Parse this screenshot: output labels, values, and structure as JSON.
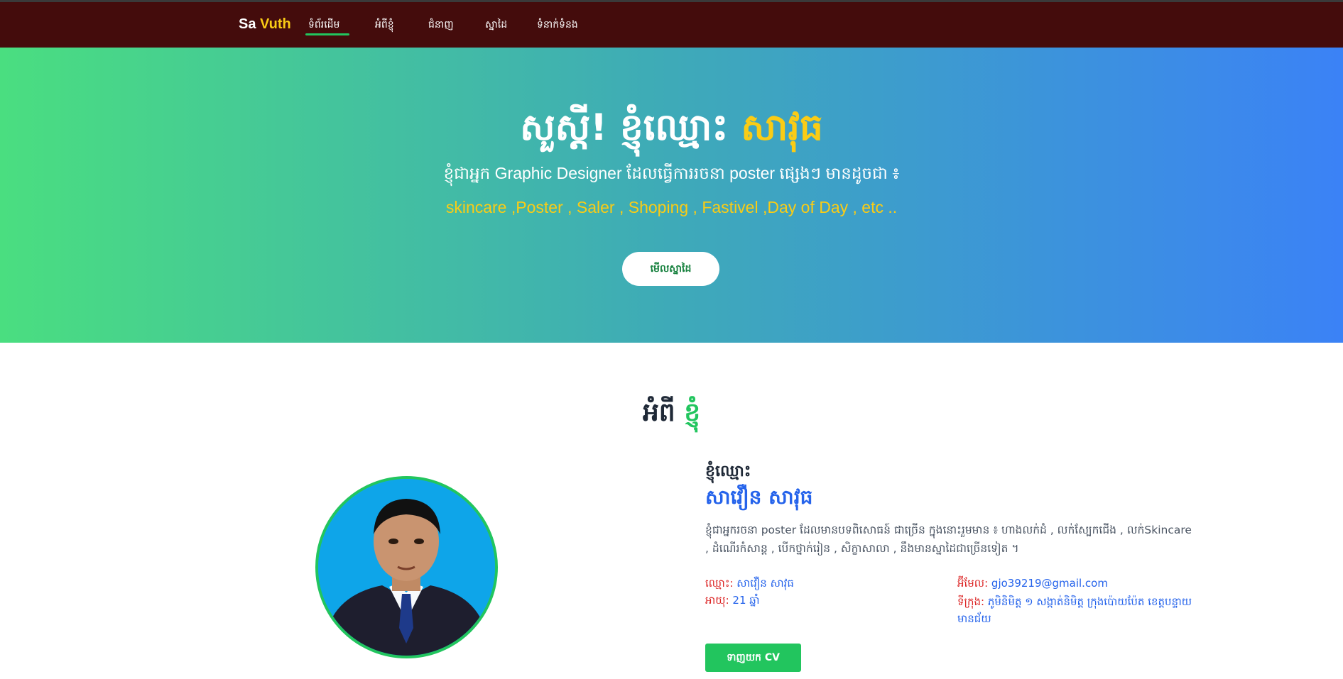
{
  "nav": {
    "brand_first": "Sa",
    "brand_second": "Vuth",
    "items": [
      "ទំព័រដើម",
      "អំពីខ្ញុំ",
      "ជំនាញ",
      "ស្នាដៃ",
      "ទំនាក់ទំនង"
    ],
    "active_index": 0
  },
  "hero": {
    "greeting": "សួស្តី! ខ្ញុំឈ្មោះ",
    "name": "សាវុធ",
    "subtitle": "ខ្ញុំជាអ្នក Graphic Designer ដែលធ្វើការរចនា poster ផ្សេងៗ មានដូចជា ៖",
    "tags": "skincare ,Poster , Saler , Shoping , Fastivel ,Day of Day , etc ..",
    "button_label": "មើលស្នាដៃ"
  },
  "about": {
    "heading_first": "អំពី",
    "heading_second": "ខ្ញុំ",
    "intro_label": "ខ្ញុំឈ្មោះ",
    "full_name": "សាវឿន សាវុធ",
    "bio": "ខ្ញុំជាអ្នករចនា poster ដែលមានបទពិសោធន៍ ជាច្រើន ក្នុងនោះរួមមាន ៖ ហាងលក់ដំ , លក់ស្បែកជើង , លក់Skincare , ដំណើរកំសាន្ត , បើកថ្នាក់រៀន , សិក្ខាសាលា , នឹងមានស្នាដៃជាច្រើនទៀត ។",
    "name_label": "ឈ្មោះ:",
    "name_value": "សាវឿន សាវុធ",
    "age_label": "អាយុ:",
    "age_value": "21 ឆ្នាំ",
    "email_label": "អ៊ីមែល:",
    "email_value": "gjo39219@gmail.com",
    "address_label": "ទីក្រុង:",
    "address_value": "ភូមិនិមិត្ត ១ សង្កាត់និមិត្ត ក្រុងប៉ោយប៉ែត ខេត្តបន្ទាយមានជ័យ",
    "cv_button_label": "ទាញយក CV"
  },
  "colors": {
    "nav_bg": "#440c0c",
    "accent_yellow": "#facc15",
    "accent_green": "#22c55e",
    "accent_blue": "#2563eb",
    "label_red": "#dc2626",
    "hero_gradient_start": "#4ade80",
    "hero_gradient_end": "#3b82f6"
  }
}
